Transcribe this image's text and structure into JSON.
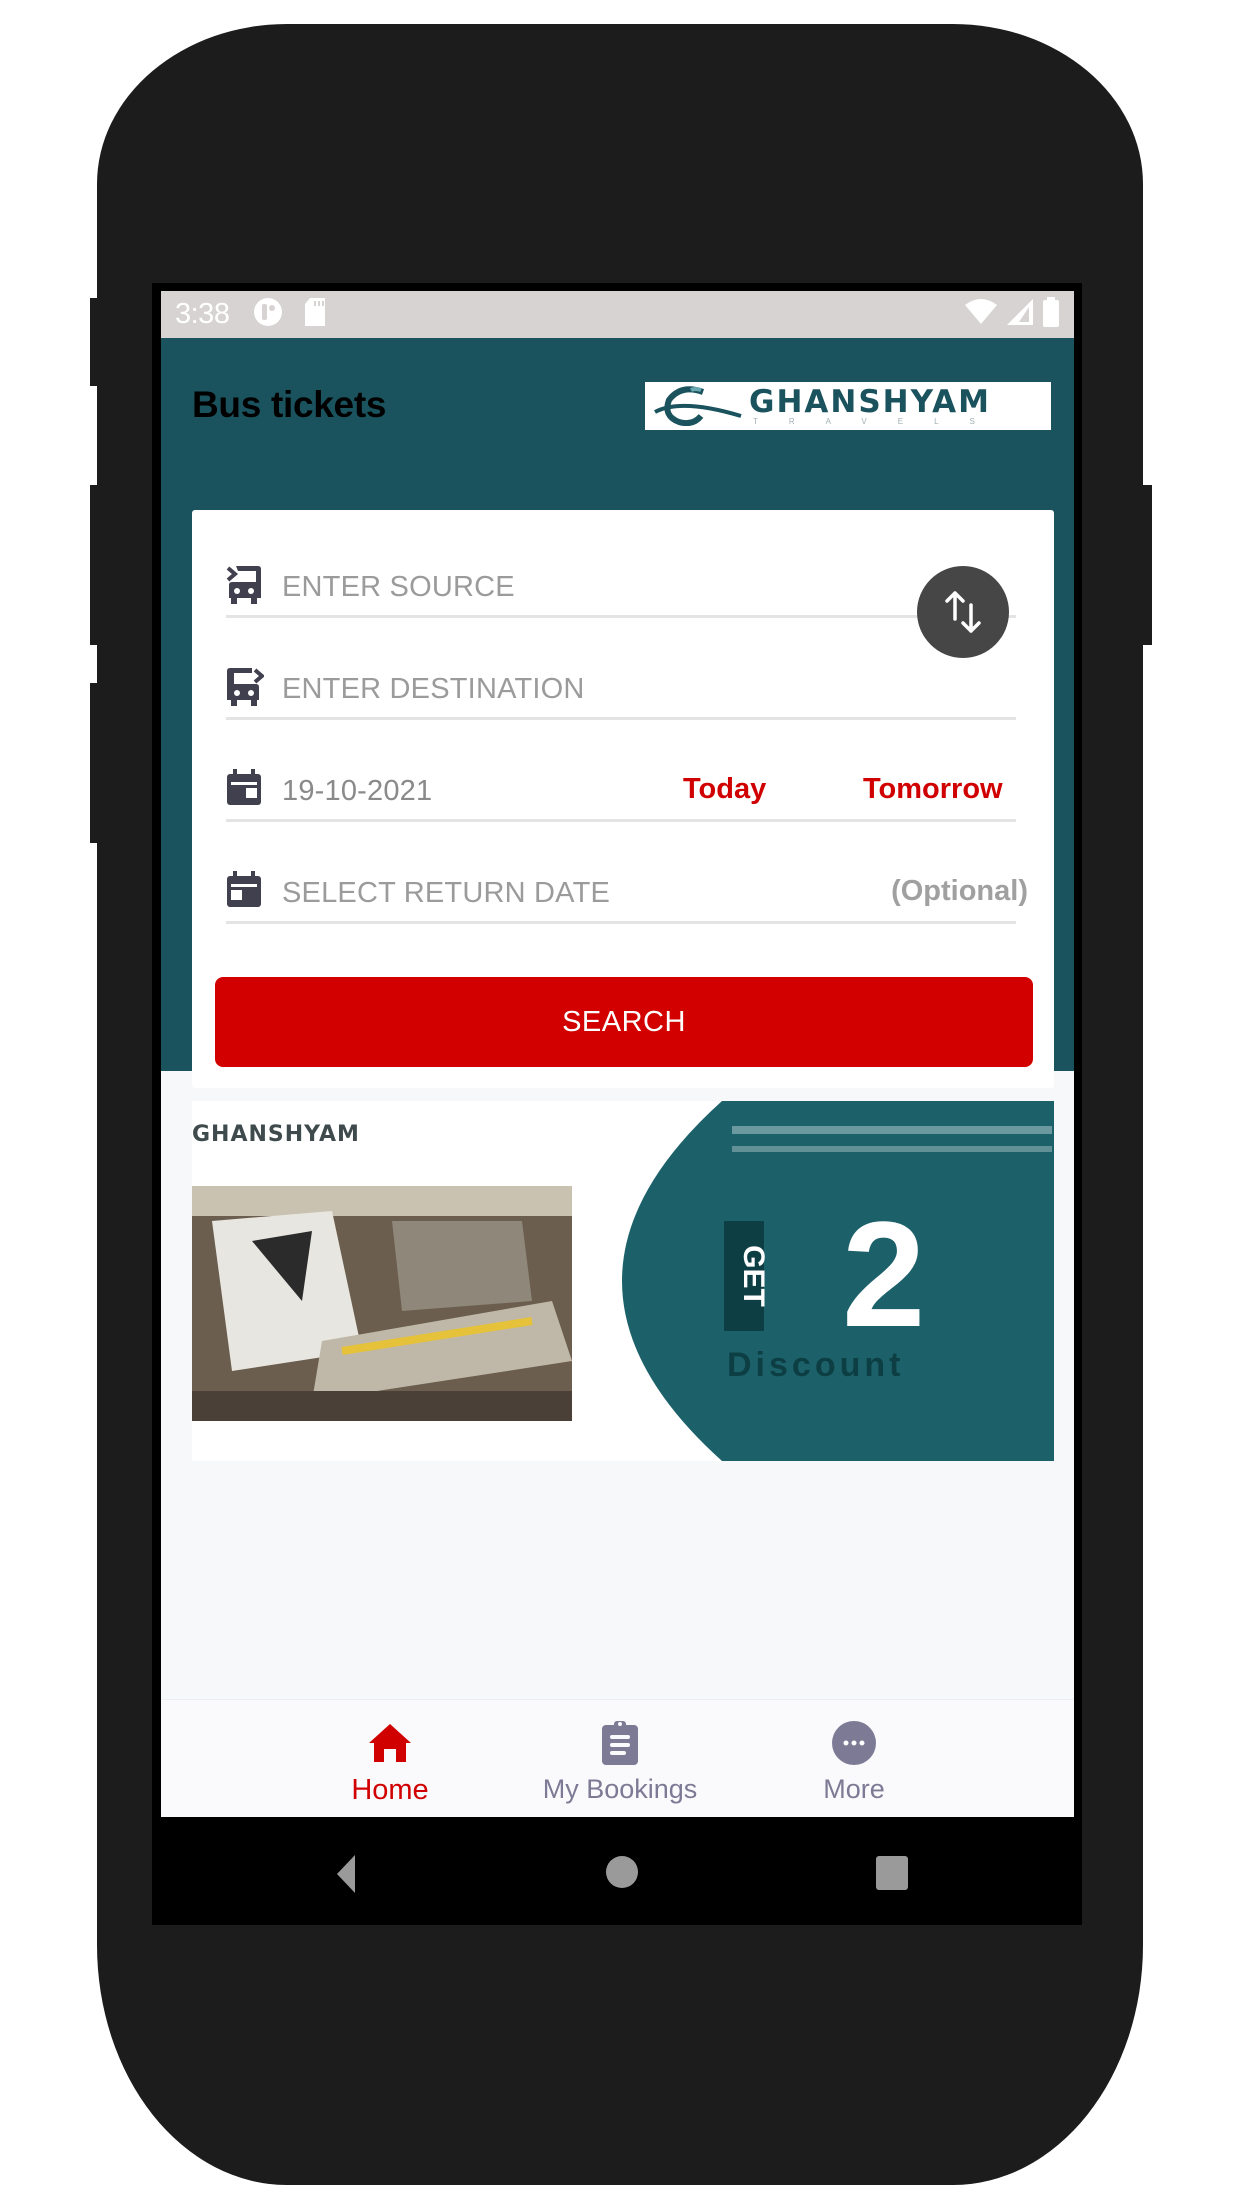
{
  "status_bar": {
    "time": "3:38",
    "left_icons": [
      "app-notification-icon",
      "sd-card-icon"
    ],
    "right_icons": [
      "wifi-icon",
      "cell-signal-icon",
      "battery-icon"
    ]
  },
  "header": {
    "title": "Bus tickets",
    "logo": {
      "name": "GHANSHYAM",
      "tagline": "TRAVELS"
    }
  },
  "search_form": {
    "source": {
      "placeholder": "ENTER SOURCE",
      "icon": "bus-source-icon"
    },
    "destination": {
      "placeholder": "ENTER DESTINATION",
      "icon": "bus-destination-icon"
    },
    "swap_icon": "swap-vertical-icon",
    "journey_date": {
      "value": "19-10-2021",
      "icon": "calendar-icon",
      "today_label": "Today",
      "tomorrow_label": "Tomorrow"
    },
    "return_date": {
      "placeholder": "SELECT RETURN DATE",
      "optional_label": "(Optional)",
      "icon": "calendar-icon"
    },
    "search_label": "SEARCH"
  },
  "banner": {
    "brand": "GHANSHYAM",
    "headline_prefix": "GET",
    "headline_value": "2",
    "sub": "Discount"
  },
  "bottom_nav": {
    "items": [
      {
        "label": "Home",
        "icon": "home-icon",
        "active": true
      },
      {
        "label": "My Bookings",
        "icon": "clipboard-icon",
        "active": false
      },
      {
        "label": "More",
        "icon": "more-icon",
        "active": false
      }
    ]
  },
  "colors": {
    "primary": "#1a525e",
    "accent": "#d10000",
    "nav_inactive": "#7d7a95"
  }
}
